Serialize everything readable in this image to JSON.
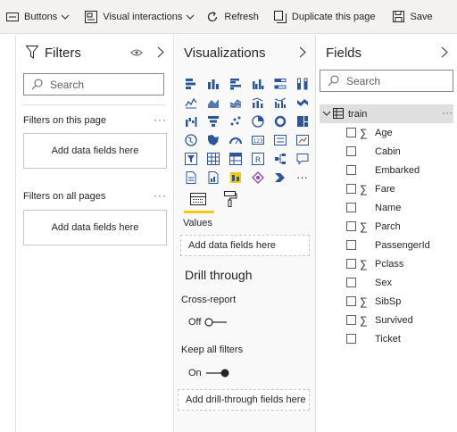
{
  "toolbar": {
    "buttons": "Buttons",
    "visual_interactions": "Visual interactions",
    "refresh": "Refresh",
    "duplicate": "Duplicate this page",
    "save": "Save",
    "more": "···"
  },
  "filters": {
    "title": "Filters",
    "search_placeholder": "Search",
    "on_this_page": "Filters on this page",
    "on_all_pages": "Filters on all pages",
    "add_fields": "Add data fields here",
    "more": "···"
  },
  "visualizations": {
    "title": "Visualizations",
    "more_visuals": "···",
    "values_label": "Values",
    "values_drop": "Add data fields here",
    "drill_through": "Drill through",
    "cross_report": "Cross-report",
    "cross_report_state": "Off",
    "keep_all_filters": "Keep all filters",
    "keep_all_filters_state": "On",
    "drill_drop": "Add drill-through fields here"
  },
  "fields": {
    "title": "Fields",
    "search_placeholder": "Search",
    "table_name": "train",
    "more": "···",
    "items": [
      {
        "name": "Age",
        "sigma": true
      },
      {
        "name": "Cabin",
        "sigma": false
      },
      {
        "name": "Embarked",
        "sigma": false
      },
      {
        "name": "Fare",
        "sigma": true
      },
      {
        "name": "Name",
        "sigma": false
      },
      {
        "name": "Parch",
        "sigma": true
      },
      {
        "name": "PassengerId",
        "sigma": false
      },
      {
        "name": "Pclass",
        "sigma": true
      },
      {
        "name": "Sex",
        "sigma": false
      },
      {
        "name": "SibSp",
        "sigma": true
      },
      {
        "name": "Survived",
        "sigma": true
      },
      {
        "name": "Ticket",
        "sigma": false
      }
    ]
  },
  "colors": {
    "accent_yellow": "#f2c811",
    "viz_blue": "#2b579a",
    "border": "#e1dfdd"
  }
}
